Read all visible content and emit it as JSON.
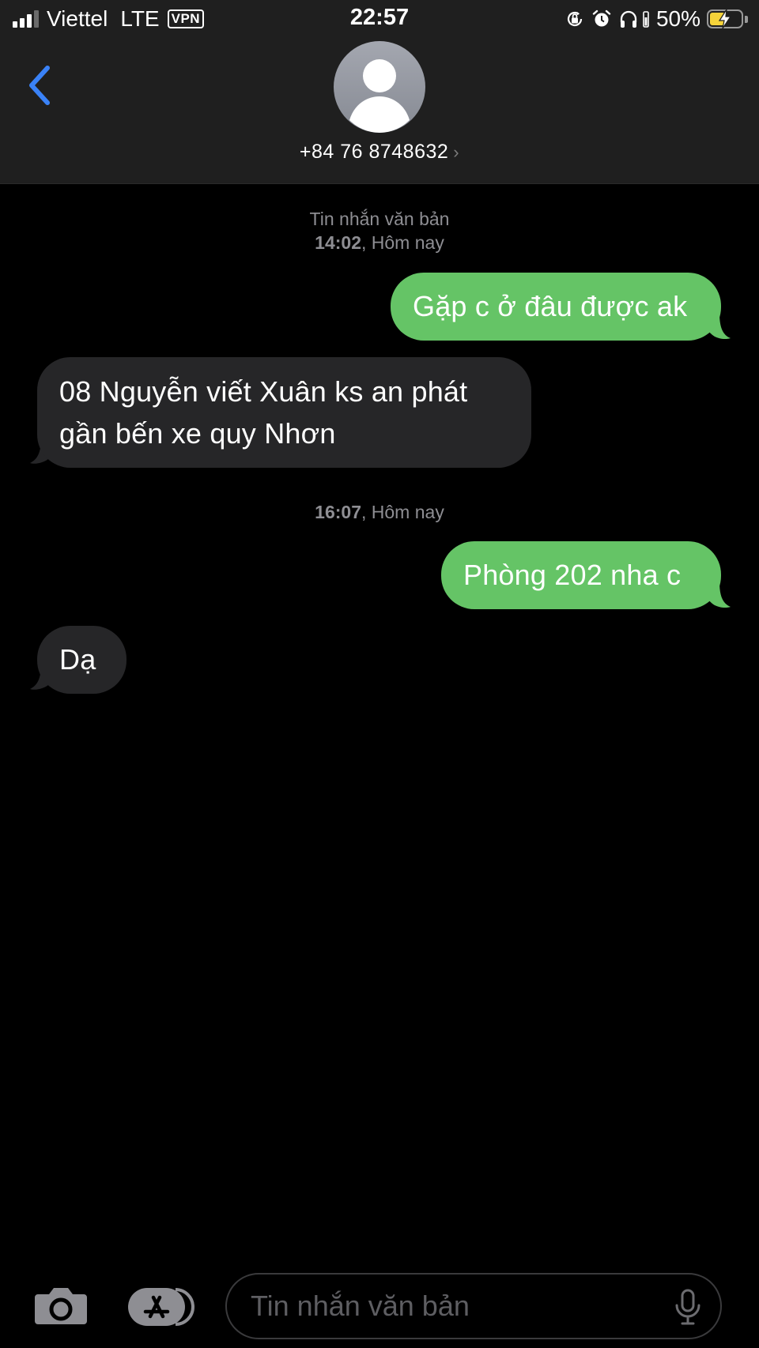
{
  "status_bar": {
    "carrier": "Viettel",
    "network": "LTE",
    "vpn_label": "VPN",
    "time": "22:57",
    "battery_percent_label": "50%",
    "battery_level": 0.5,
    "signal_bars": 3,
    "signal_bars_total": 4,
    "icons": [
      "signal-icon",
      "orientation-lock-icon",
      "alarm-icon",
      "headphones-icon",
      "battery-charging-icon"
    ]
  },
  "header": {
    "contact": "+84 76 8748632",
    "chevron": "›",
    "icons": [
      "back-chevron-icon",
      "person-avatar-icon"
    ]
  },
  "conversation": [
    {
      "type": "timestamp",
      "label": "Tin nhắn văn bản",
      "time": "14:02",
      "day": ", Hôm nay"
    },
    {
      "type": "sent",
      "text": "Gặp c ở đâu được ak"
    },
    {
      "type": "received",
      "lines": [
        "08 Nguyễn viết Xuân ks an phát",
        "gần bến xe quy Nhơn"
      ]
    },
    {
      "type": "timestamp",
      "time": "16:07",
      "day": ", Hôm nay"
    },
    {
      "type": "sent",
      "text": "Phòng 202 nha c"
    },
    {
      "type": "received",
      "text": "Dạ"
    }
  ],
  "input_bar": {
    "placeholder": "Tin nhắn văn bản",
    "value": "",
    "icons": [
      "camera-icon",
      "app-store-icon",
      "microphone-icon"
    ]
  },
  "colors": {
    "sent_bubble": "#65c466",
    "received_bubble": "#262628",
    "accent_blue": "#3a82f7",
    "header_bg": "#1f1f1f",
    "timestamp_gray": "#8e8e93"
  }
}
